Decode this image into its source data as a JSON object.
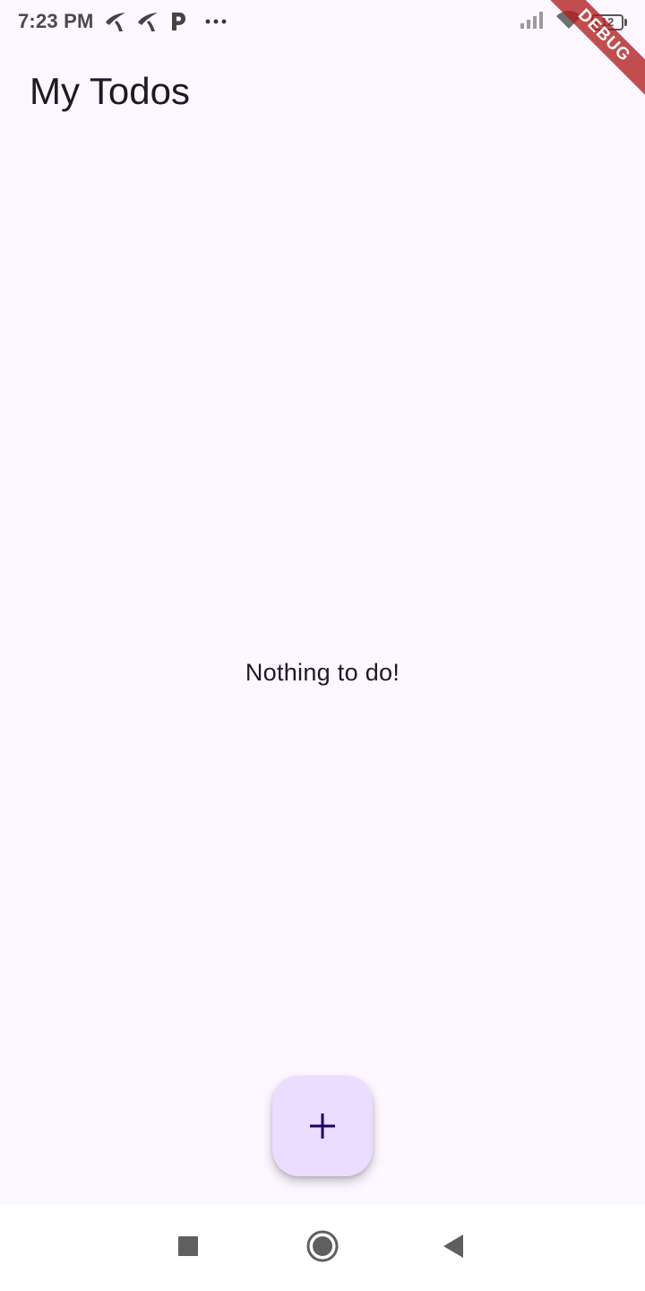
{
  "status_bar": {
    "time": "7:23 PM",
    "battery_level": "12",
    "battery_fill_color": "#e53935",
    "icons": [
      "telenor-icon",
      "telenor-icon",
      "p-app-icon",
      "more-dots-icon",
      "signal-icon",
      "wifi-icon",
      "battery-icon"
    ]
  },
  "debug_banner": {
    "label": "DEBUG",
    "color": "#b01e1e"
  },
  "app_bar": {
    "title": "My Todos"
  },
  "body": {
    "empty_message": "Nothing to do!"
  },
  "fab": {
    "icon": "plus-icon",
    "background": "#eaddff",
    "icon_color": "#21005d"
  },
  "nav_bar": {
    "icons": [
      "recents-icon",
      "home-icon",
      "back-icon"
    ]
  },
  "colors": {
    "background": "#fdf7ff",
    "text": "#1d1b20"
  }
}
